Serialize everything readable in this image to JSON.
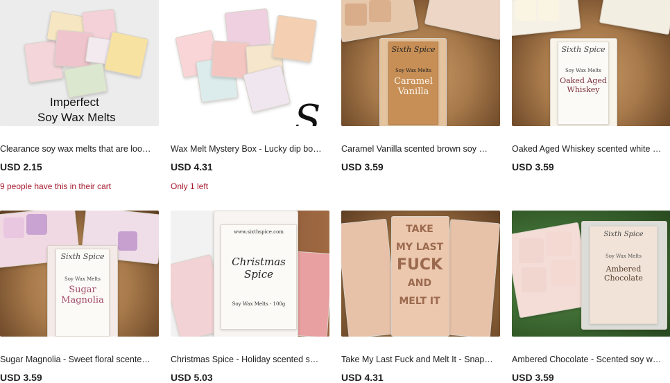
{
  "products": [
    {
      "title": "Clearance soy wax melts that are looki...",
      "price": "USD 2.15",
      "note": "9 people have this in their cart",
      "image_text": [
        "Imperfect",
        "Soy Wax Melts"
      ]
    },
    {
      "title": "Wax Melt Mystery Box - Lucky dip box fi...",
      "price": "USD 4.31",
      "note": "Only 1 left"
    },
    {
      "title": "Caramel Vanilla scented brown soy wa...",
      "price": "USD 3.59",
      "image_text": [
        "Sixth Spice",
        "Soy Wax Melts",
        "Caramel",
        "Vanilla"
      ]
    },
    {
      "title": "Oaked Aged Whiskey scented white so...",
      "price": "USD 3.59",
      "image_text": [
        "Sixth Spice",
        "Soy Wax Melts",
        "Oaked Aged",
        "Whiskey"
      ]
    },
    {
      "title": "Sugar Magnolia - Sweet floral scented ...",
      "price": "USD 3.59",
      "image_text": [
        "Sixth Spice",
        "Soy Wax Melts",
        "Sugar",
        "Magnolia"
      ]
    },
    {
      "title": "Christmas Spice - Holiday scented soy ...",
      "price": "USD 5.03",
      "image_text": [
        "www.sixthspice.com",
        "Christmas",
        "Spice",
        "Soy Wax Melts - 100g"
      ]
    },
    {
      "title": "Take My Last Fuck and Melt It - Snap ba...",
      "price": "USD 4.31",
      "image_text": [
        "TAKE",
        "MY LAST",
        "FUCK",
        "AND",
        "MELT IT"
      ]
    },
    {
      "title": "Ambered Chocolate - Scented soy wax ...",
      "price": "USD 3.59",
      "image_text": [
        "Sixth Spice",
        "Soy Wax Melts",
        "Ambered",
        "Chocolate"
      ]
    }
  ],
  "colors": {
    "note_red": "#a61a2e",
    "text": "#222222"
  }
}
